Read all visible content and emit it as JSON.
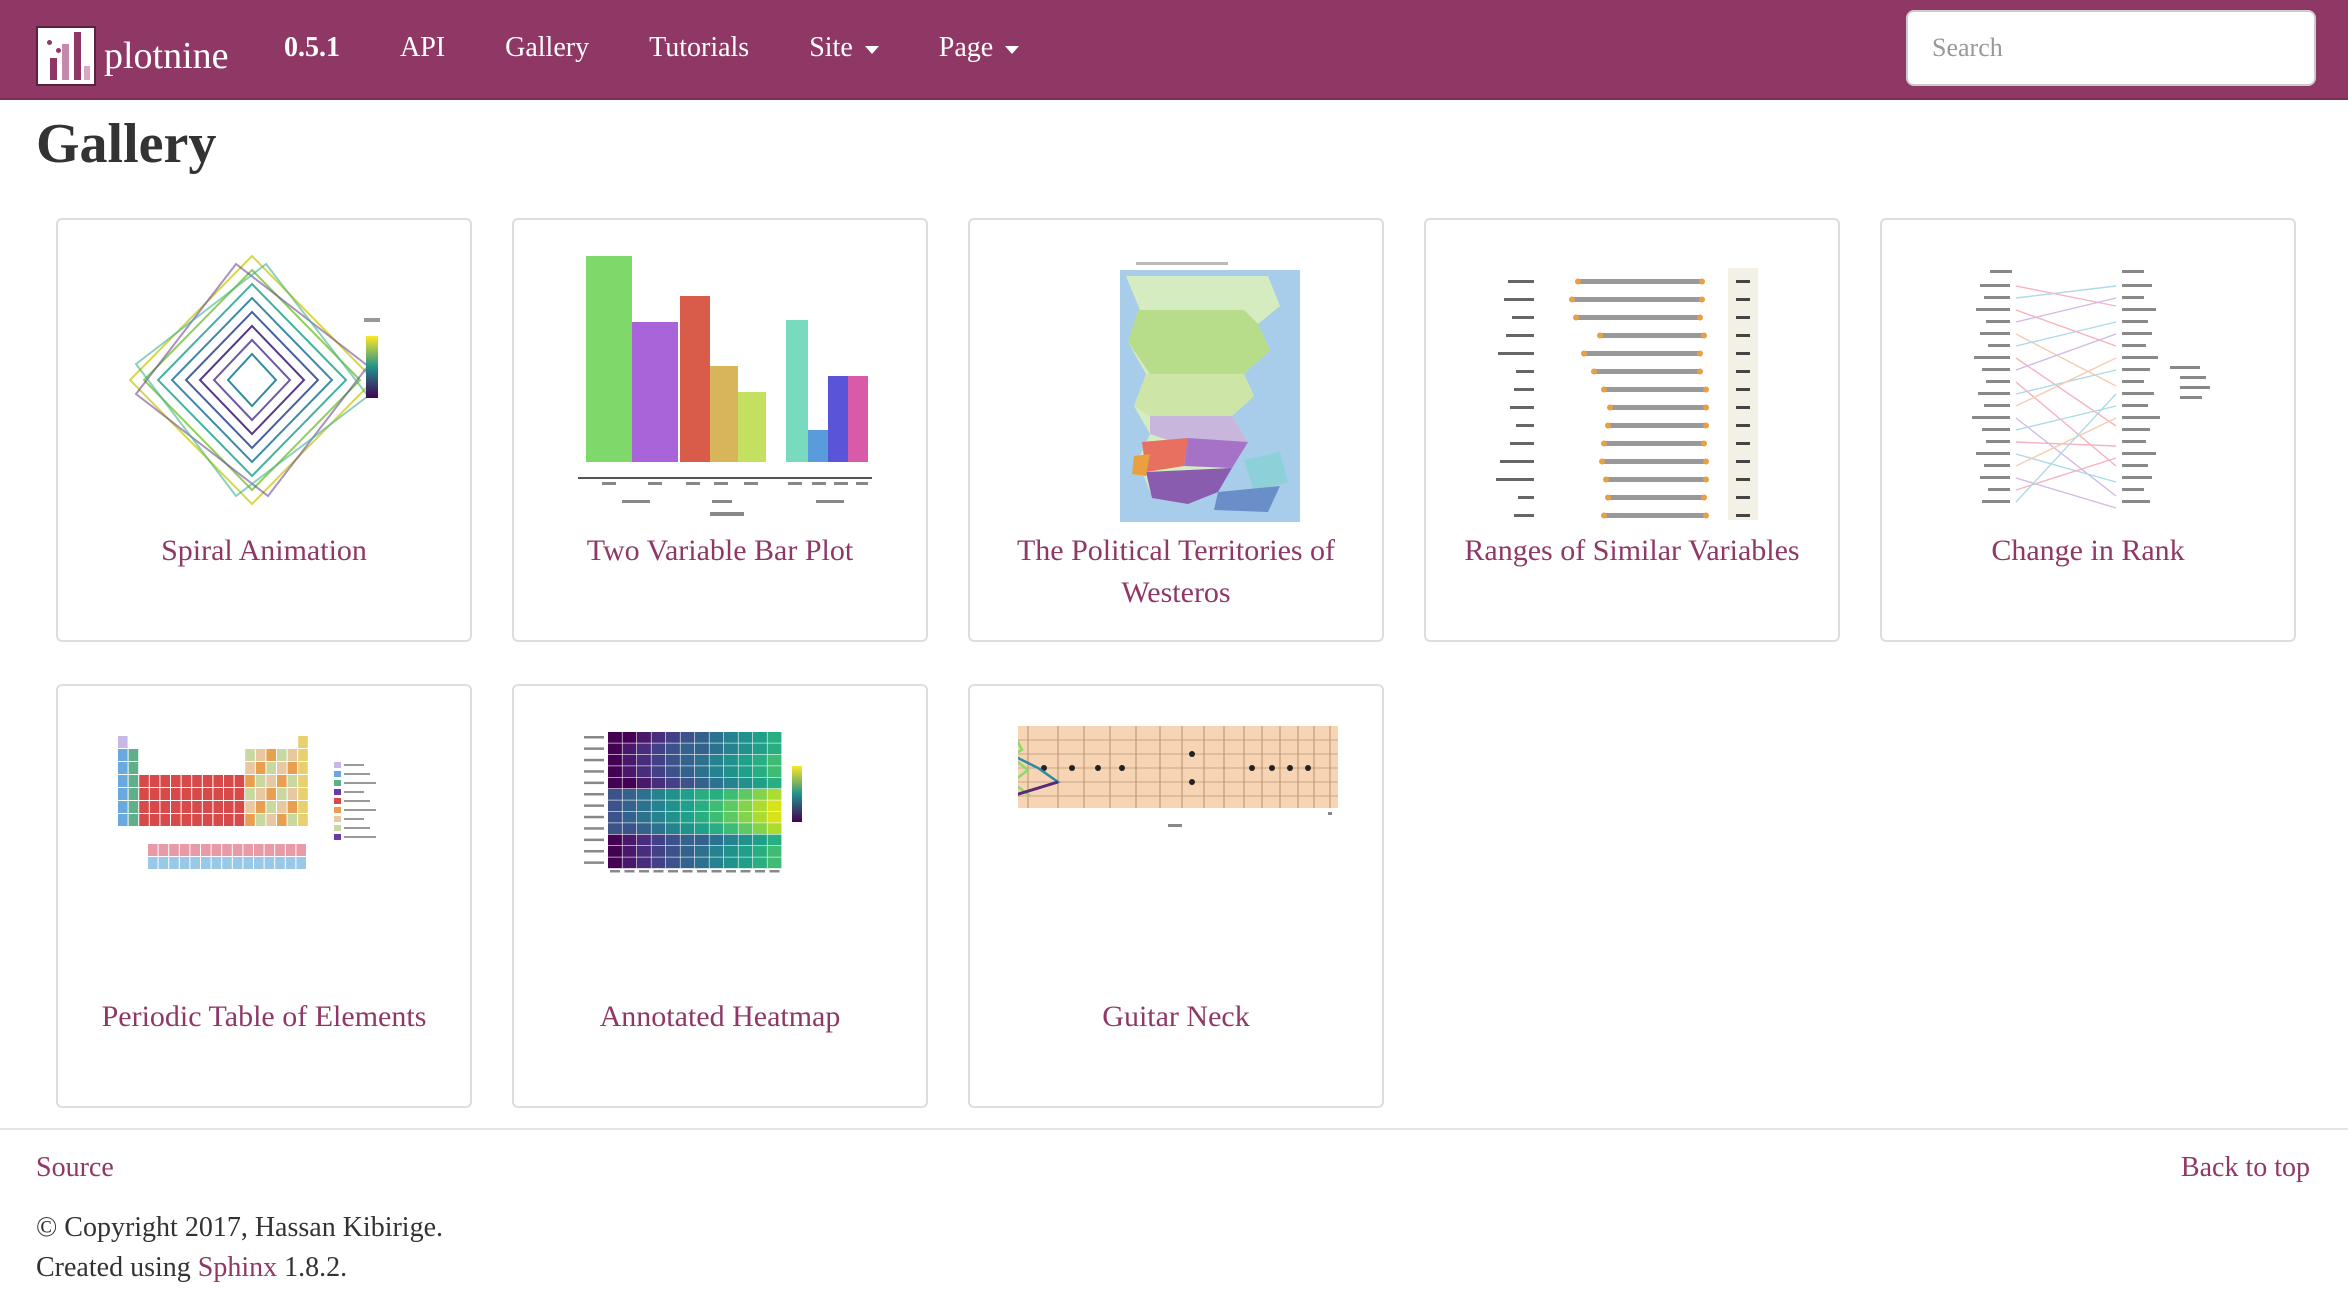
{
  "navbar": {
    "brand": "plotnine",
    "items": [
      {
        "label": "0.5.1",
        "dropdown": false
      },
      {
        "label": "API",
        "dropdown": false
      },
      {
        "label": "Gallery",
        "dropdown": false
      },
      {
        "label": "Tutorials",
        "dropdown": false
      },
      {
        "label": "Site",
        "dropdown": true
      },
      {
        "label": "Page",
        "dropdown": true
      }
    ],
    "search_placeholder": "Search",
    "colors": {
      "navbar_bg": "#8f3866",
      "link": "#8f3866"
    }
  },
  "main": {
    "title": "Gallery",
    "cards": [
      {
        "label": "Spiral Animation",
        "thumbnail": "spiral-thumbnail"
      },
      {
        "label": "Two Variable Bar Plot",
        "thumbnail": "bar-plot-thumbnail"
      },
      {
        "label": "The Political Territories of Westeros",
        "thumbnail": "westeros-map-thumbnail"
      },
      {
        "label": "Ranges of Similar Variables",
        "thumbnail": "ranges-thumbnail"
      },
      {
        "label": "Change in Rank",
        "thumbnail": "rank-change-thumbnail"
      },
      {
        "label": "Periodic Table of Elements",
        "thumbnail": "periodic-table-thumbnail"
      },
      {
        "label": "Annotated Heatmap",
        "thumbnail": "heatmap-thumbnail"
      },
      {
        "label": "Guitar Neck",
        "thumbnail": "guitar-neck-thumbnail"
      }
    ]
  },
  "footer": {
    "source": "Source",
    "back_to_top": "Back to top",
    "copyright": "© Copyright 2017, Hassan Kibirige.",
    "created_prefix": "Created using ",
    "sphinx_link": "Sphinx",
    "created_suffix": " 1.8.2."
  }
}
